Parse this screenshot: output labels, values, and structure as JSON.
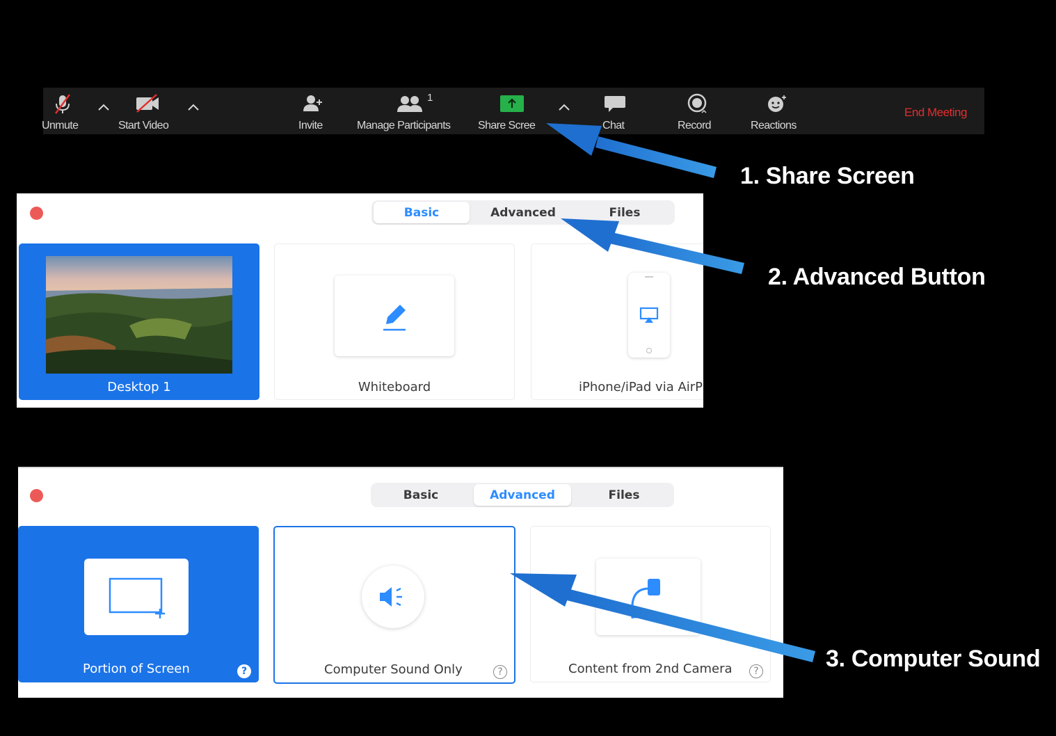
{
  "toolbar": {
    "items": [
      {
        "label": "Unmute",
        "icon": "muted-microphone-icon"
      },
      {
        "label": "Start Video",
        "icon": "video-off-icon"
      },
      {
        "label": "Invite",
        "icon": "add-person-icon"
      },
      {
        "label": "Manage Participants",
        "icon": "participants-icon",
        "badge": "1"
      },
      {
        "label": "Share Screen",
        "icon": "share-screen-icon"
      },
      {
        "label": "Chat",
        "icon": "chat-bubble-icon"
      },
      {
        "label": "Record",
        "icon": "record-icon"
      },
      {
        "label": "Reactions",
        "icon": "smiley-icon"
      }
    ],
    "end_meeting": "End Meeting",
    "share_screen_visible": "Share Scree"
  },
  "callouts": {
    "one": "1. Share Screen",
    "two": "2. Advanced Button",
    "three": "3. Computer Sound"
  },
  "panel_basic": {
    "tabs": [
      "Basic",
      "Advanced",
      "Files"
    ],
    "active_tab": "Basic",
    "cards": [
      {
        "label": "Desktop 1",
        "selected": true
      },
      {
        "label": "Whiteboard"
      },
      {
        "label": "iPhone/iPad via AirP"
      }
    ]
  },
  "panel_advanced": {
    "tabs": [
      "Basic",
      "Advanced",
      "Files"
    ],
    "active_tab": "Advanced",
    "cards": [
      {
        "label": "Portion of Screen",
        "selected": true,
        "help": "?"
      },
      {
        "label": "Computer Sound Only",
        "outlined": true,
        "help": "?"
      },
      {
        "label": "Content from 2nd Camera",
        "help": "?"
      }
    ]
  },
  "colors": {
    "accent": "#1b73e8",
    "tab_active_text": "#2d8cff",
    "end_meeting": "#e02f2f",
    "share_green": "#26b14a",
    "arrow": "#1f7fd6"
  }
}
